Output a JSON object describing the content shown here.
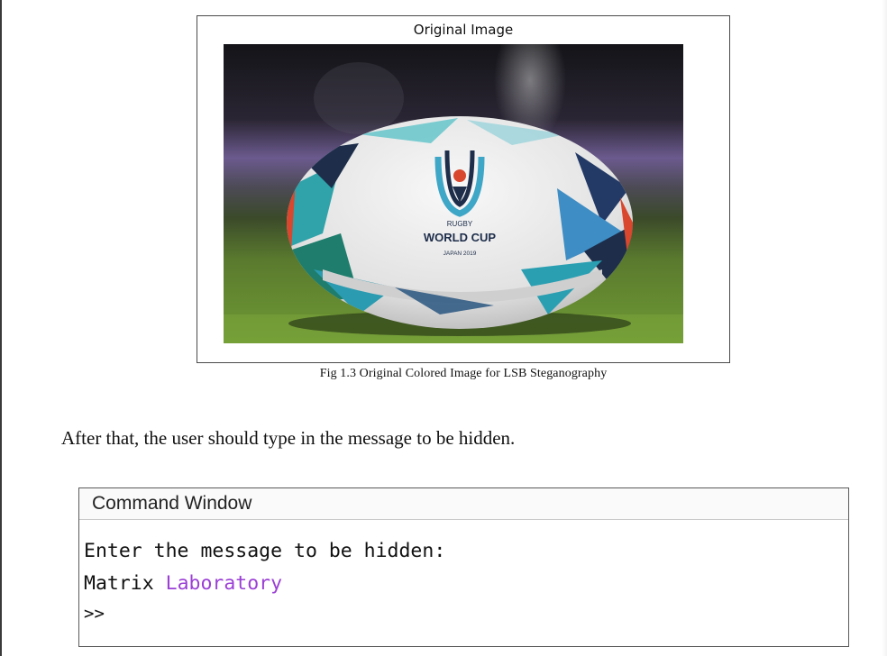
{
  "figure": {
    "title": "Original Image",
    "ball_text": {
      "line1": "RUGBY",
      "line2": "WORLD CUP",
      "line3": "JAPAN 2019"
    },
    "caption": "Fig 1.3 Original Colored Image for LSB Steganography"
  },
  "paragraph": "After that, the user should type in the message to be hidden.",
  "command_window": {
    "title": "Command Window",
    "prompt_text": "Enter the message to be hidden:",
    "input_word1": "Matrix",
    "input_word2": "Laboratory",
    "prompt": ">>"
  }
}
